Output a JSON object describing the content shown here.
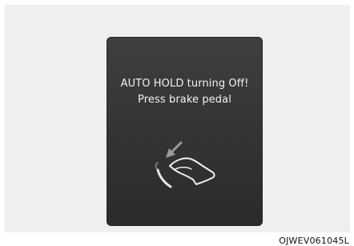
{
  "display": {
    "line1": "AUTO HOLD turning Off!",
    "line2": "Press brake pedal",
    "icon": "brake-pedal-press-icon",
    "background_color": "#333333",
    "text_color": "#f2f2f2",
    "frame_color": "#efefef"
  },
  "caption": {
    "code": "OJWEV061045L"
  }
}
